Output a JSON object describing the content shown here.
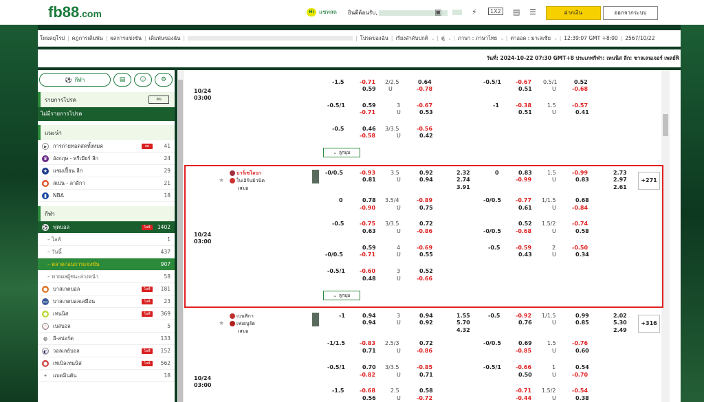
{
  "header": {
    "logo": "fb88",
    "logo_suffix": ".com",
    "chat_label": "แชทสด",
    "welcome": "ยินดีต้อนรับ,",
    "deposit": "ฝากเงิน",
    "logout": "ออกจากระบบ"
  },
  "menu": {
    "items": [
      "โหมดยุโรป",
      "คฎการเดิมพัน",
      "ผลการแข่งขัน",
      "เดิมพันของฉัน",
      "โปรดของฉัน",
      "เรียงลำดับปกติ",
      "คู่",
      "ภาษา : ภาษาไทย",
      "ค่าออด : มาเลเซีย",
      "12:39:07 GMT +8:00",
      "2567/10/22"
    ]
  },
  "ticker": "วันที่: 2024-10-22 07:30 GMT+8 ประเภทกีฬา: เทนนิส ลีก: ชาลเลนเจอร์ เพลย์ฟิ",
  "sidebar": {
    "sports_tab": "กีฬา",
    "fav_title": "รายการโปรด",
    "fav_btn": "ลบ",
    "fav_empty": "ไม่มีรายการโปรด",
    "rec_title": "แนะนำ",
    "rec": [
      {
        "label": "การถ่ายทอดสดทั้งหมด",
        "count": "41",
        "live": "สด"
      },
      {
        "label": "อังกฤษ - พรีเมียร์ ลีก",
        "count": "24"
      },
      {
        "label": "แชมเปี้ยน ลีก",
        "count": "29"
      },
      {
        "label": "สเปน - ลาลีกา",
        "count": "21"
      },
      {
        "label": "NBA",
        "count": "18"
      }
    ],
    "sport_title": "กีฬา",
    "football": {
      "label": "ฟุตบอล",
      "count": "1402",
      "live": "ไลฟ์"
    },
    "sub": [
      {
        "label": "ไลฟ์",
        "count": "1"
      },
      {
        "label": "วันนี้",
        "count": "437"
      },
      {
        "label": "ตลาดก่อนการแข่งขัน",
        "count": "907"
      },
      {
        "label": "ทายผลผู้ชนะล่วงหน้า",
        "count": "58"
      }
    ],
    "sports": [
      {
        "label": "บาสเกตบอล",
        "count": "181",
        "live": "ไลฟ์"
      },
      {
        "label": "บาสเกตบอลเสมือน",
        "count": "23",
        "live": "ไลฟ์"
      },
      {
        "label": "เทนนิส",
        "count": "369",
        "live": "ไลฟ์"
      },
      {
        "label": "เบสบอล",
        "count": "5"
      },
      {
        "label": "อี-สปอร์ต",
        "count": "133"
      },
      {
        "label": "วอลเลย์บอล",
        "count": "152",
        "live": "ไลฟ์"
      },
      {
        "label": "เทเบิลเทนนิส",
        "count": "562",
        "live": "ไลฟ์"
      },
      {
        "label": "แบดมินตัน",
        "count": "18"
      }
    ]
  },
  "matches": {
    "date1": "10/24",
    "time1": "03:00",
    "date2": "10/24",
    "time2": "03:00",
    "date3": "10/24",
    "time3": "03:00",
    "more": "ลูกมุม",
    "m2": {
      "home": "บาร์เซโลนา",
      "away": "ไบเอิร์นมิวนิค",
      "draw": "เสมอ",
      "plus": "+271"
    },
    "m3": {
      "home": "เบนฟิกา",
      "away": "เฟเยนูร์ด",
      "draw": "เสมอ",
      "plus": "+316"
    }
  }
}
